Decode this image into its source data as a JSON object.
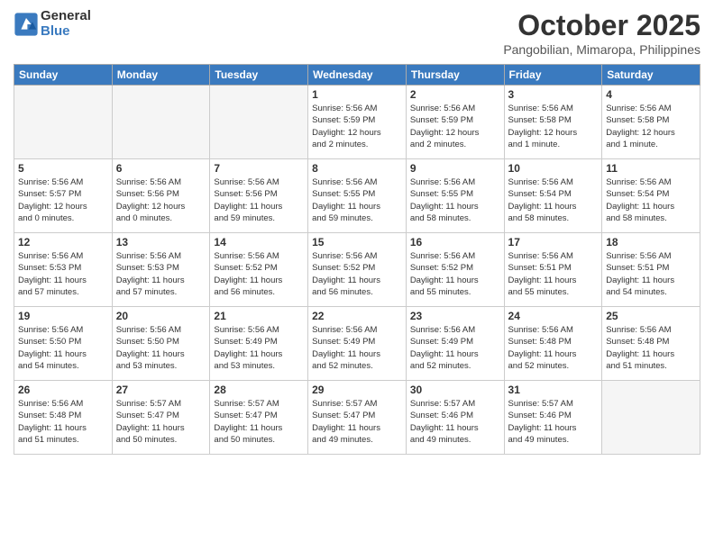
{
  "logo": {
    "general": "General",
    "blue": "Blue"
  },
  "header": {
    "title": "October 2025",
    "subtitle": "Pangobilian, Mimaropa, Philippines"
  },
  "weekdays": [
    "Sunday",
    "Monday",
    "Tuesday",
    "Wednesday",
    "Thursday",
    "Friday",
    "Saturday"
  ],
  "weeks": [
    [
      {
        "day": "",
        "info": ""
      },
      {
        "day": "",
        "info": ""
      },
      {
        "day": "",
        "info": ""
      },
      {
        "day": "1",
        "info": "Sunrise: 5:56 AM\nSunset: 5:59 PM\nDaylight: 12 hours\nand 2 minutes."
      },
      {
        "day": "2",
        "info": "Sunrise: 5:56 AM\nSunset: 5:59 PM\nDaylight: 12 hours\nand 2 minutes."
      },
      {
        "day": "3",
        "info": "Sunrise: 5:56 AM\nSunset: 5:58 PM\nDaylight: 12 hours\nand 1 minute."
      },
      {
        "day": "4",
        "info": "Sunrise: 5:56 AM\nSunset: 5:58 PM\nDaylight: 12 hours\nand 1 minute."
      }
    ],
    [
      {
        "day": "5",
        "info": "Sunrise: 5:56 AM\nSunset: 5:57 PM\nDaylight: 12 hours\nand 0 minutes."
      },
      {
        "day": "6",
        "info": "Sunrise: 5:56 AM\nSunset: 5:56 PM\nDaylight: 12 hours\nand 0 minutes."
      },
      {
        "day": "7",
        "info": "Sunrise: 5:56 AM\nSunset: 5:56 PM\nDaylight: 11 hours\nand 59 minutes."
      },
      {
        "day": "8",
        "info": "Sunrise: 5:56 AM\nSunset: 5:55 PM\nDaylight: 11 hours\nand 59 minutes."
      },
      {
        "day": "9",
        "info": "Sunrise: 5:56 AM\nSunset: 5:55 PM\nDaylight: 11 hours\nand 58 minutes."
      },
      {
        "day": "10",
        "info": "Sunrise: 5:56 AM\nSunset: 5:54 PM\nDaylight: 11 hours\nand 58 minutes."
      },
      {
        "day": "11",
        "info": "Sunrise: 5:56 AM\nSunset: 5:54 PM\nDaylight: 11 hours\nand 58 minutes."
      }
    ],
    [
      {
        "day": "12",
        "info": "Sunrise: 5:56 AM\nSunset: 5:53 PM\nDaylight: 11 hours\nand 57 minutes."
      },
      {
        "day": "13",
        "info": "Sunrise: 5:56 AM\nSunset: 5:53 PM\nDaylight: 11 hours\nand 57 minutes."
      },
      {
        "day": "14",
        "info": "Sunrise: 5:56 AM\nSunset: 5:52 PM\nDaylight: 11 hours\nand 56 minutes."
      },
      {
        "day": "15",
        "info": "Sunrise: 5:56 AM\nSunset: 5:52 PM\nDaylight: 11 hours\nand 56 minutes."
      },
      {
        "day": "16",
        "info": "Sunrise: 5:56 AM\nSunset: 5:52 PM\nDaylight: 11 hours\nand 55 minutes."
      },
      {
        "day": "17",
        "info": "Sunrise: 5:56 AM\nSunset: 5:51 PM\nDaylight: 11 hours\nand 55 minutes."
      },
      {
        "day": "18",
        "info": "Sunrise: 5:56 AM\nSunset: 5:51 PM\nDaylight: 11 hours\nand 54 minutes."
      }
    ],
    [
      {
        "day": "19",
        "info": "Sunrise: 5:56 AM\nSunset: 5:50 PM\nDaylight: 11 hours\nand 54 minutes."
      },
      {
        "day": "20",
        "info": "Sunrise: 5:56 AM\nSunset: 5:50 PM\nDaylight: 11 hours\nand 53 minutes."
      },
      {
        "day": "21",
        "info": "Sunrise: 5:56 AM\nSunset: 5:49 PM\nDaylight: 11 hours\nand 53 minutes."
      },
      {
        "day": "22",
        "info": "Sunrise: 5:56 AM\nSunset: 5:49 PM\nDaylight: 11 hours\nand 52 minutes."
      },
      {
        "day": "23",
        "info": "Sunrise: 5:56 AM\nSunset: 5:49 PM\nDaylight: 11 hours\nand 52 minutes."
      },
      {
        "day": "24",
        "info": "Sunrise: 5:56 AM\nSunset: 5:48 PM\nDaylight: 11 hours\nand 52 minutes."
      },
      {
        "day": "25",
        "info": "Sunrise: 5:56 AM\nSunset: 5:48 PM\nDaylight: 11 hours\nand 51 minutes."
      }
    ],
    [
      {
        "day": "26",
        "info": "Sunrise: 5:56 AM\nSunset: 5:48 PM\nDaylight: 11 hours\nand 51 minutes."
      },
      {
        "day": "27",
        "info": "Sunrise: 5:57 AM\nSunset: 5:47 PM\nDaylight: 11 hours\nand 50 minutes."
      },
      {
        "day": "28",
        "info": "Sunrise: 5:57 AM\nSunset: 5:47 PM\nDaylight: 11 hours\nand 50 minutes."
      },
      {
        "day": "29",
        "info": "Sunrise: 5:57 AM\nSunset: 5:47 PM\nDaylight: 11 hours\nand 49 minutes."
      },
      {
        "day": "30",
        "info": "Sunrise: 5:57 AM\nSunset: 5:46 PM\nDaylight: 11 hours\nand 49 minutes."
      },
      {
        "day": "31",
        "info": "Sunrise: 5:57 AM\nSunset: 5:46 PM\nDaylight: 11 hours\nand 49 minutes."
      },
      {
        "day": "",
        "info": ""
      }
    ]
  ]
}
